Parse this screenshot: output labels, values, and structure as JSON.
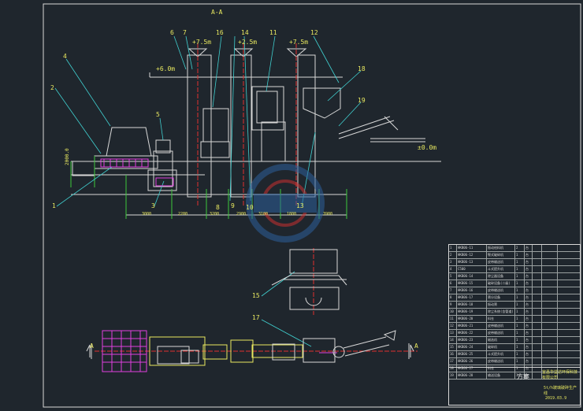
{
  "drawing": {
    "section_mark": "A-A",
    "level_marks": [
      "+7.5m",
      "+2.5m",
      "+7.5m",
      "+6.0m",
      "±0.0m"
    ],
    "left_dim": "2000.0",
    "callouts": [
      "1",
      "2",
      "3",
      "4",
      "5",
      "6",
      "7",
      "8",
      "9",
      "10",
      "11",
      "12",
      "13",
      "14",
      "15",
      "16",
      "17",
      "18",
      "19"
    ],
    "bottom_dims": [
      "3000",
      "2200",
      "3200",
      "3100",
      "1800",
      "3900",
      "2900"
    ],
    "section_letters": [
      "A",
      "A"
    ]
  },
  "title_block": {
    "rows": [
      [
        "1",
        "HKB06-11",
        "振动给料机",
        "2",
        "台",
        "",
        "",
        ""
      ],
      [
        "2",
        "HKB06-12",
        "颚式破碎机",
        "1",
        "台",
        "",
        "",
        ""
      ],
      [
        "3",
        "HKB06-13",
        "皮带输送机",
        "1",
        "台",
        "",
        "",
        ""
      ],
      [
        "4",
        "C500",
        "斗式提升机",
        "1",
        "台",
        "",
        "",
        ""
      ],
      [
        "5",
        "HKB06-14",
        "除尘器设备",
        "1",
        "台",
        "",
        "",
        ""
      ],
      [
        "6",
        "HKB06-15",
        "破碎设备(二级)",
        "1",
        "台",
        "",
        "",
        ""
      ],
      [
        "7",
        "HKB06-16",
        "皮带输送机",
        "1",
        "台",
        "",
        "",
        ""
      ],
      [
        "8",
        "HKB06-17",
        "筛分设备",
        "1",
        "台",
        "",
        "",
        ""
      ],
      [
        "9",
        "HKB06-18",
        "振动筛",
        "1",
        "台",
        "",
        "",
        ""
      ],
      [
        "10",
        "HKB06-19",
        "除尘系统(含管道)",
        "1",
        "台",
        "",
        "",
        ""
      ],
      [
        "11",
        "HKB06-20",
        "料仓",
        "1",
        "台",
        "",
        "",
        ""
      ],
      [
        "12",
        "HKB06-21",
        "皮带输送机",
        "1",
        "台",
        "",
        "",
        ""
      ],
      [
        "13",
        "HKB06-22",
        "皮带输送机",
        "1",
        "台",
        "",
        "",
        ""
      ],
      [
        "14",
        "HKB06-23",
        "磁选机",
        "1",
        "台",
        "",
        "",
        ""
      ],
      [
        "15",
        "HKB06-24",
        "破碎机",
        "1",
        "台",
        "",
        "",
        ""
      ],
      [
        "16",
        "HKB06-25",
        "斗式提升机",
        "1",
        "台",
        "",
        "",
        ""
      ],
      [
        "17",
        "HKB06-26",
        "皮带输送机",
        "1",
        "台",
        "",
        "",
        ""
      ],
      [
        "18",
        "HKB06-27",
        "料仓",
        "1",
        "台",
        "",
        "",
        ""
      ],
      [
        "19",
        "HKB06-28",
        "输送设备",
        "1",
        "台",
        "",
        "",
        ""
      ]
    ],
    "plan_title": "方案",
    "company": "宜昌华益达环保科技有限公司",
    "drawing_name": "5t/h玻璃破碎生产线",
    "drawing_code": "2019.03.9"
  }
}
